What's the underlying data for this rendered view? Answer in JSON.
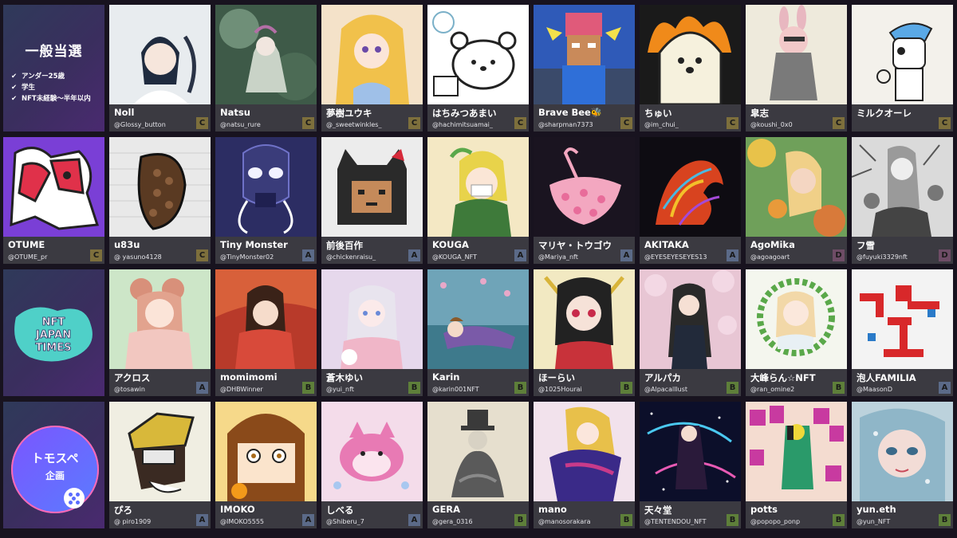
{
  "lottery": {
    "title": "一般当選",
    "criteria": [
      "アンダー25歳",
      "学生",
      "NFT未経験〜半年以内"
    ],
    "check_glyph": "✔"
  },
  "promo": {
    "times_logo_line1": "NFT",
    "times_logo_line2": "JAPAN",
    "times_logo_line3": "TIMES",
    "tomo_line1": "トモスペ",
    "tomo_line2": "企画"
  },
  "rank_colors": {
    "A": "#5b6a88",
    "B": "#5e7f3a",
    "C": "#7d6f3c",
    "D": "#6e4c66"
  },
  "cards": [
    {
      "name": "Noll",
      "handle": "@Glossy_button",
      "rank": "C"
    },
    {
      "name": "Natsu",
      "handle": "@natsu_rure",
      "rank": "C"
    },
    {
      "name": "夢樹ユウキ",
      "handle": "@_sweetwinkles_",
      "rank": "C"
    },
    {
      "name": "はちみつあまい",
      "handle": "@hachimitsuamai_",
      "rank": "C"
    },
    {
      "name": "Brave Bee🐝",
      "handle": "@sharpman7373",
      "rank": "C"
    },
    {
      "name": "ちゅい",
      "handle": "@im_chui_",
      "rank": "C"
    },
    {
      "name": "皐志",
      "handle": "@koushi_0x0",
      "rank": "C"
    },
    {
      "name": "ミルクオーレ",
      "handle": "",
      "rank": "C"
    },
    {
      "name": "OTUME",
      "handle": "@OTUME_pr",
      "rank": "C"
    },
    {
      "name": "u83u",
      "handle": "@ yasuno4128",
      "rank": "C"
    },
    {
      "name": "Tiny Monster",
      "handle": "@TinyMonster02",
      "rank": "A"
    },
    {
      "name": "前後百作",
      "handle": "@chickenraisu_",
      "rank": "A"
    },
    {
      "name": "KOUGA",
      "handle": "@KOUGA_NFT",
      "rank": "A"
    },
    {
      "name": "マリヤ・トウゴウ",
      "handle": "@Mariya_nft",
      "rank": "A"
    },
    {
      "name": "AKITAKA",
      "handle": "@EYESEYESEYES13",
      "rank": "A"
    },
    {
      "name": "AgoMika",
      "handle": "@agoagoart",
      "rank": "D"
    },
    {
      "name": "フ雪",
      "handle": "@fuyuki3329nft",
      "rank": "D"
    },
    {
      "name": "アクロス",
      "handle": "@tosawin",
      "rank": "A"
    },
    {
      "name": "momimomi",
      "handle": "@DHBWinner",
      "rank": "B"
    },
    {
      "name": "蒼木ゆい",
      "handle": "@yui_nft",
      "rank": "B"
    },
    {
      "name": "Karin",
      "handle": "@karin001NFT",
      "rank": "B"
    },
    {
      "name": "ほーらい",
      "handle": "@1025Hourai",
      "rank": "B"
    },
    {
      "name": "アルパカ",
      "handle": "@Alpacalllust",
      "rank": "B"
    },
    {
      "name": "大峰らん☆NFT",
      "handle": "@ran_omine2",
      "rank": "B"
    },
    {
      "name": "泡人FAMILIA",
      "handle": "@MaasonD",
      "rank": "A"
    },
    {
      "name": "ぴろ",
      "handle": "@ piro1909",
      "rank": "A"
    },
    {
      "name": "IMOKO",
      "handle": "@IMOKO5555",
      "rank": "A"
    },
    {
      "name": "しべる",
      "handle": "@Shiberu_7",
      "rank": "A"
    },
    {
      "name": "GERA",
      "handle": "@gera_0316",
      "rank": "B"
    },
    {
      "name": "mano",
      "handle": "@manosorakara",
      "rank": "B"
    },
    {
      "name": "天々堂",
      "handle": "@TENTENDOU_NFT",
      "rank": "B"
    },
    {
      "name": "potts",
      "handle": "@popopo_ponp",
      "rank": "B"
    },
    {
      "name": "yun.eth",
      "handle": "@yun_NFT",
      "rank": "B"
    }
  ]
}
